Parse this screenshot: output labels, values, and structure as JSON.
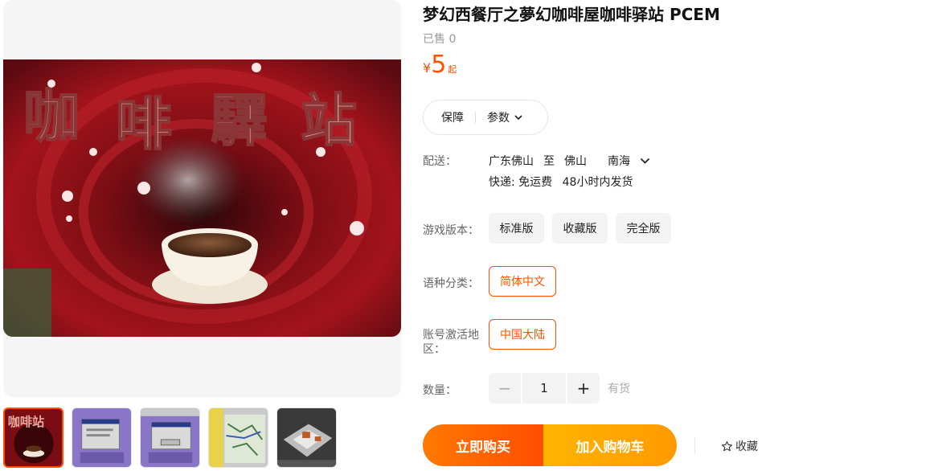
{
  "product": {
    "title": "梦幻西餐厅之夢幻咖啡屋咖啡驿站 PCEM",
    "sold": "已售 0",
    "price_currency": "¥",
    "price_value": "5",
    "price_suffix": "起"
  },
  "tabs": {
    "guarantee": "保障",
    "params": "参数"
  },
  "shipping": {
    "label": "配送：",
    "from": "广东佛山",
    "to_word": "至",
    "city": "佛山",
    "district": "南海",
    "express": "快递: 免运费",
    "dispatch": "48小时内发货"
  },
  "version": {
    "label": "游戏版本：",
    "options": [
      "标准版",
      "收藏版",
      "完全版"
    ]
  },
  "language": {
    "label": "语种分类：",
    "options": [
      "简体中文"
    ]
  },
  "region": {
    "label": "账号激活地区：",
    "options": [
      "中国大陆"
    ]
  },
  "quantity": {
    "label": "数量：",
    "minus": "−",
    "value": "1",
    "plus": "+",
    "stock": "有货"
  },
  "actions": {
    "buy_now": "立即购买",
    "add_cart": "加入购物车",
    "favorite": "收藏"
  },
  "icons": {
    "chevron": "chevron-down-icon",
    "star": "star-icon"
  },
  "colors": {
    "accent": "#ff5000",
    "buy_start": "#ff7a00",
    "cart": "#ffa800"
  }
}
